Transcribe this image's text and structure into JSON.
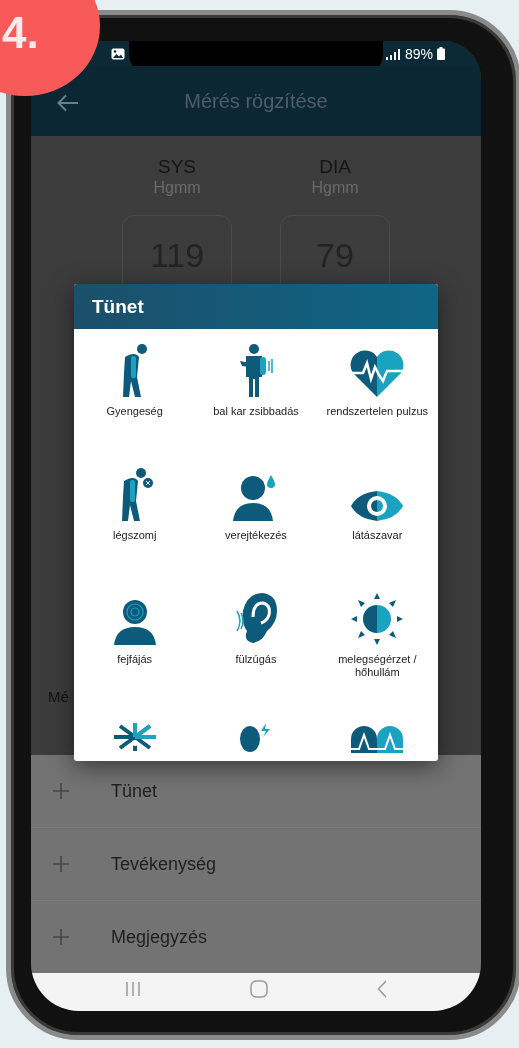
{
  "badge": {
    "label": "4."
  },
  "status_bar": {
    "battery": "89%"
  },
  "header": {
    "title": "Mérés rögzítése"
  },
  "readings": [
    {
      "label": "SYS",
      "unit": "Hgmm",
      "value": "119"
    },
    {
      "label": "DIA",
      "unit": "Hgmm",
      "value": "79"
    }
  ],
  "partial_label": "Mé",
  "dialog": {
    "title": "Tünet",
    "items": [
      {
        "kind": "bent",
        "label": "Gyengeség"
      },
      {
        "kind": "arm",
        "label": "bal kar zsibbadás"
      },
      {
        "kind": "heart",
        "label": "rendszertelen pulzus"
      },
      {
        "kind": "cough",
        "label": "légszomj"
      },
      {
        "kind": "drop",
        "label": "verejtékezés"
      },
      {
        "kind": "eye",
        "label": "látászavar"
      },
      {
        "kind": "headache",
        "label": "fejfájás"
      },
      {
        "kind": "ear",
        "label": "fülzúgás"
      },
      {
        "kind": "sun",
        "label": "melegségérzet / hőhullám"
      },
      {
        "kind": "snow"
      },
      {
        "kind": "bolt"
      },
      {
        "kind": "arches"
      }
    ]
  },
  "sections": [
    {
      "label": "Tünet"
    },
    {
      "label": "Tevékenység"
    },
    {
      "label": "Megjegyzés"
    }
  ]
}
